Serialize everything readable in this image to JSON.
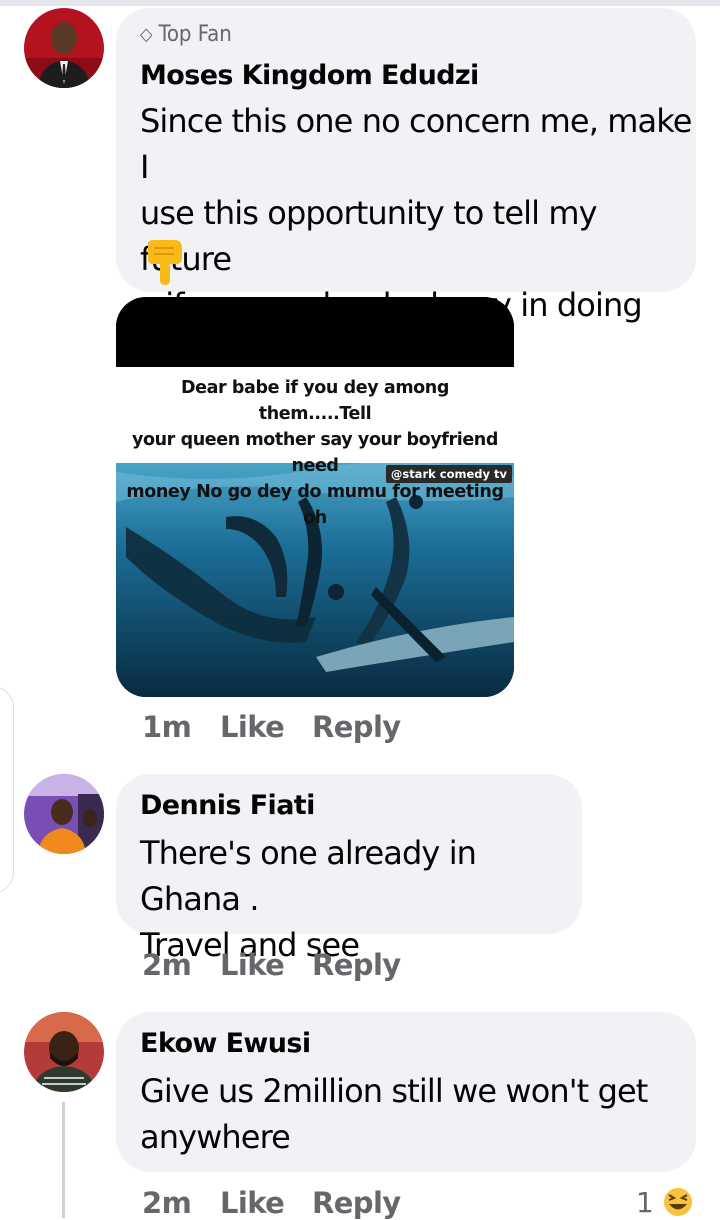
{
  "comments": [
    {
      "badge": "Top Fan",
      "author": "Moses Kingdom Edudzi",
      "text_lines": [
        "Since this one no concern me, make I",
        "use this opportunity to tell my future",
        "wife say make she hurry in doing this"
      ],
      "emoji": "backhand-index-pointing-down",
      "attachment": {
        "caption_lines": [
          "Dear babe if you dey among them.....Tell",
          "your queen mother say your boyfriend need",
          "money No go dey do mumu for meeting oh"
        ],
        "watermark": "@stark comedy tv"
      },
      "time": "1m",
      "like": "Like",
      "reply": "Reply"
    },
    {
      "author": "Dennis Fiati",
      "text_lines": [
        "There's one already in Ghana .",
        "Travel and see"
      ],
      "time": "2m",
      "like": "Like",
      "reply": "Reply"
    },
    {
      "author": "Ekow Ewusi",
      "text_lines": [
        "Give us 2million still we won't get",
        "anywhere"
      ],
      "time": "2m",
      "like": "Like",
      "reply": "Reply",
      "reactions": {
        "count": "1",
        "icon": "laughing-face-icon"
      }
    }
  ],
  "colors": {
    "bubble": "#f0f2f5",
    "meta_text": "#65676b",
    "body_text": "#050505"
  }
}
